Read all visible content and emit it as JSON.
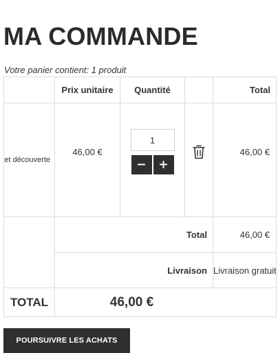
{
  "page": {
    "title": "MA COMMANDE",
    "cart_summary": "Votre panier contient: 1 produit"
  },
  "table": {
    "headers": {
      "product": "",
      "unit_price": "Prix unitaire",
      "quantity": "Quantité",
      "remove": "",
      "total": "Total"
    },
    "items": [
      {
        "name": "Coffret découverte",
        "unit_price": "46,00 €",
        "quantity": "1",
        "minus_label": "−",
        "plus_label": "+",
        "remove_icon": "trash-icon",
        "line_total": "46,00 €"
      }
    ],
    "subtotal_label": "Total",
    "subtotal_value": "46,00 €",
    "shipping_label": "Livraison",
    "shipping_value": "Livraison gratuite!",
    "grand_total_label": "TOTAL",
    "grand_total_value": "46,00 €"
  },
  "actions": {
    "continue_label": "POURSUIVRE LES ACHATS"
  },
  "colors": {
    "button_bg": "#2f2f2f",
    "border": "#dcdcdc",
    "text": "#333333"
  }
}
